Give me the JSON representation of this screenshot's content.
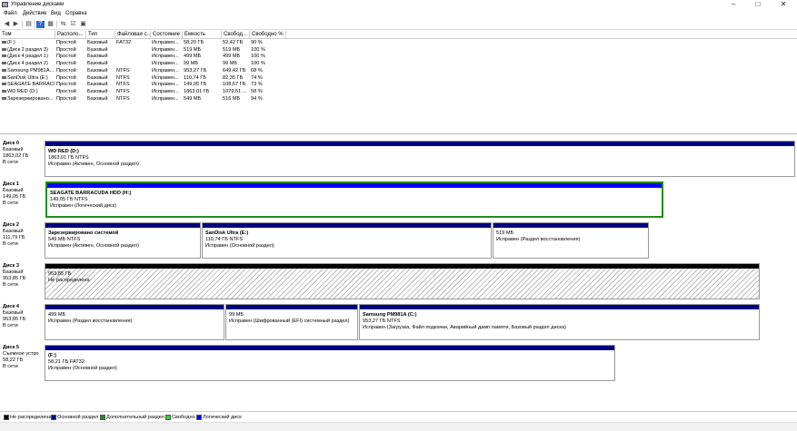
{
  "window": {
    "title": "Управление дисками",
    "minimize": "–",
    "maximize": "□",
    "close": "✕"
  },
  "menu": [
    "Файл",
    "Действие",
    "Вид",
    "Справка"
  ],
  "columns": [
    "Том",
    "Располо...",
    "Тип",
    "Файловая с...",
    "Состояние",
    "Емкость",
    "Свобод...",
    "Свободно %"
  ],
  "volumes": [
    [
      "(F:)",
      "Простой",
      "Базовый",
      "FAT32",
      "Исправен...",
      "58,20 ГБ",
      "52,42 ГБ",
      "90 %"
    ],
    [
      "(Диск 2 раздел 3)",
      "Простой",
      "Базовый",
      "",
      "Исправен...",
      "519 МБ",
      "519 МБ",
      "100 %"
    ],
    [
      "(Диск 4 раздел 1)",
      "Простой",
      "Базовый",
      "",
      "Исправен...",
      "499 МБ",
      "499 МБ",
      "100 %"
    ],
    [
      "(Диск 4 раздел 2)",
      "Простой",
      "Базовый",
      "",
      "Исправен...",
      "99 МБ",
      "99 МБ",
      "100 %"
    ],
    [
      "Samsung PM981A...",
      "Простой",
      "Базовый",
      "NTFS",
      "Исправен...",
      "953,27 ГБ",
      "649,42 ГБ",
      "68 %"
    ],
    [
      "SanDisk Ultra (E:)",
      "Простой",
      "Базовый",
      "NTFS",
      "Исправен...",
      "110,74 ГБ",
      "82,35 ГБ",
      "74 %"
    ],
    [
      "SEAGATE BARRACU...",
      "Простой",
      "Базовый",
      "NTFS",
      "Исправен...",
      "149,05 ГБ",
      "108,67 ГБ",
      "73 %"
    ],
    [
      "WD RED (D:)",
      "Простой",
      "Базовый",
      "NTFS",
      "Исправен...",
      "1863,01 ГБ",
      "1079,61 ...",
      "58 %"
    ],
    [
      "Зарезервировано...",
      "Простой",
      "Базовый",
      "NTFS",
      "Исправен...",
      "549 МБ",
      "516 МБ",
      "94 %"
    ]
  ],
  "disks": [
    {
      "name": "Диск 0",
      "type": "Базовый",
      "size": "1863,02 ГБ",
      "status": "В сети",
      "partitions": [
        {
          "name": "WD RED  (D:)",
          "size": "1863,01 ГБ NTFS",
          "status": "Исправен (Активен, Основной раздел)"
        }
      ]
    },
    {
      "name": "Диск 1",
      "type": "Базовый",
      "size": "149,05 ГБ",
      "status": "В сети",
      "partitions": [
        {
          "name": "SEAGATE BARRACUDA HDD  (H:)",
          "size": "149,05 ГБ NTFS",
          "status": "Исправен (Логический диск)"
        }
      ]
    },
    {
      "name": "Диск 2",
      "type": "Базовый",
      "size": "111,79 ГБ",
      "status": "В сети",
      "partitions": [
        {
          "name": "Зарезервировано системой",
          "size": "549 МБ NTFS",
          "status": "Исправен (Активен, Основной раздел)"
        },
        {
          "name": "SanDisk Ultra  (E:)",
          "size": "110,74 ГБ NTFS",
          "status": "Исправен (Основной раздел)"
        },
        {
          "name": "",
          "size": "519 МБ",
          "status": "Исправен (Раздел восстановления)"
        }
      ]
    },
    {
      "name": "Диск 3",
      "type": "Базовый",
      "size": "953,85 ГБ",
      "status": "В сети",
      "partitions": [
        {
          "name": "",
          "size": "953,85 ГБ",
          "status": "Не распределена"
        }
      ]
    },
    {
      "name": "Диск 4",
      "type": "Базовый",
      "size": "953,85 ГБ",
      "status": "В сети",
      "partitions": [
        {
          "name": "",
          "size": "499 МБ",
          "status": "Исправен (Раздел восстановления)"
        },
        {
          "name": "",
          "size": "99 МБ",
          "status": "Исправен (Шифрованный (EFI) системный раздел)"
        },
        {
          "name": "Samsung PM981A  (C:)",
          "size": "953,27 ГБ NTFS",
          "status": "Исправен (Загрузка, Файл подкачки, Аварийный дамп памяти, Базовый раздел диска)"
        }
      ]
    },
    {
      "name": "Диск 5",
      "type": "Съемное устро",
      "size": "58,22 ГБ",
      "status": "В сети",
      "partitions": [
        {
          "name": "(F:)",
          "size": "58,21 ГБ FAT32",
          "status": "Исправен (Основной раздел)"
        }
      ]
    }
  ],
  "legend": [
    {
      "label": "Не распределена",
      "color": "#000000"
    },
    {
      "label": "Основной раздел",
      "color": "#000080"
    },
    {
      "label": "Дополнительный раздел",
      "color": "#228b22"
    },
    {
      "label": "Свободно",
      "color": "#32cd32"
    },
    {
      "label": "Логический диск",
      "color": "#0000ff"
    }
  ]
}
